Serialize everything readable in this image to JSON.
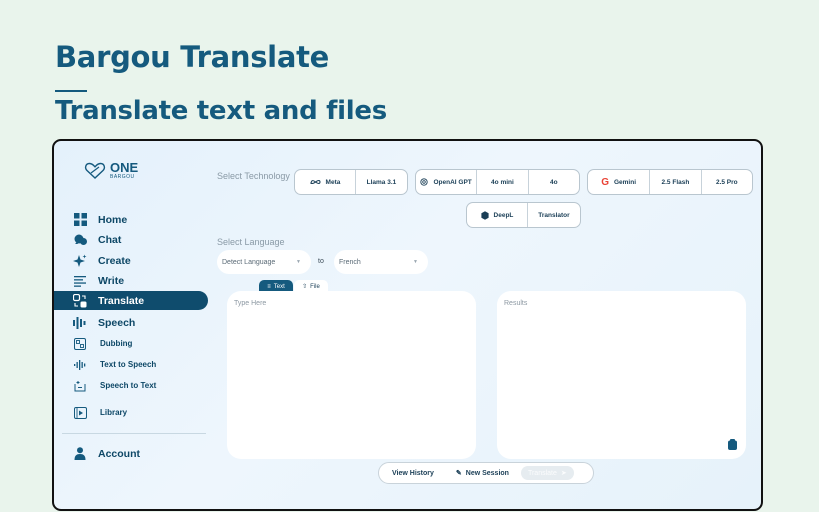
{
  "hero": {
    "title": "Bargou Translate",
    "subtitle": "Translate text and files"
  },
  "logo": {
    "one": "ONE",
    "bargou": "BARGOU"
  },
  "sidebar": {
    "items": [
      {
        "label": "Home",
        "icon": "grid-icon"
      },
      {
        "label": "Chat",
        "icon": "chat-icon"
      },
      {
        "label": "Create",
        "icon": "sparkle-icon"
      },
      {
        "label": "Write",
        "icon": "lines-icon"
      },
      {
        "label": "Translate",
        "icon": "translate-icon",
        "active": true
      },
      {
        "label": "Speech",
        "icon": "waveform-icon"
      },
      {
        "label": "Dubbing",
        "icon": "dubbing-icon"
      },
      {
        "label": "Text to Speech",
        "icon": "tts-icon"
      },
      {
        "label": "Speech to Text",
        "icon": "stt-icon"
      },
      {
        "label": "Library",
        "icon": "library-icon"
      },
      {
        "label": "Account",
        "icon": "user-icon"
      }
    ]
  },
  "technology": {
    "label": "Select Technology",
    "groups": [
      {
        "name": "Meta",
        "icon": "meta-icon",
        "models": [
          "Llama 3.1"
        ]
      },
      {
        "name": "OpenAI GPT",
        "icon": "openai-icon",
        "models": [
          "4o mini",
          "4o"
        ]
      },
      {
        "name": "Gemini",
        "icon": "google-icon",
        "models": [
          "2.5 Flash",
          "2.5 Pro"
        ]
      },
      {
        "name": "DeepL",
        "icon": "deepl-icon",
        "models": [
          "Translator"
        ]
      }
    ]
  },
  "language": {
    "label": "Select Language",
    "source": "Detect Language",
    "to": "to",
    "target": "French"
  },
  "tabs": {
    "text": "Text",
    "file": "File"
  },
  "input": {
    "placeholder": "Type Here"
  },
  "output": {
    "placeholder": "Results"
  },
  "actions": {
    "history": "View History",
    "new_session": "New Session",
    "translate": "Translate"
  },
  "colors": {
    "brand": "#155a7e",
    "active_nav": "#0f4c6d",
    "page_bg": "#e9f4ec"
  }
}
